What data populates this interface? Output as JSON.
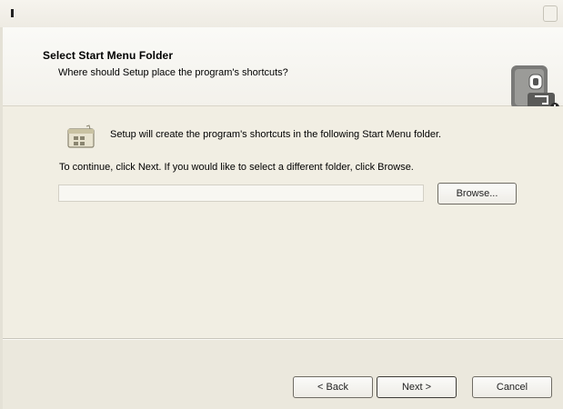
{
  "header": {
    "title": "Select Start Menu Folder",
    "subtitle": "Where should Setup place the program's shortcuts?"
  },
  "main": {
    "info_text": "Setup will create the program's shortcuts in the following Start Menu folder.",
    "continue_text": "To continue, click Next. If you would like to select a different folder, click Browse.",
    "folder_input_value": "",
    "browse_label": "Browse..."
  },
  "footer": {
    "back_label": "< Back",
    "next_label": "Next >",
    "cancel_label": "Cancel"
  },
  "icons": {
    "header_icon": "setup-computer-icon",
    "folder_icon": "start-menu-folder-icon"
  }
}
